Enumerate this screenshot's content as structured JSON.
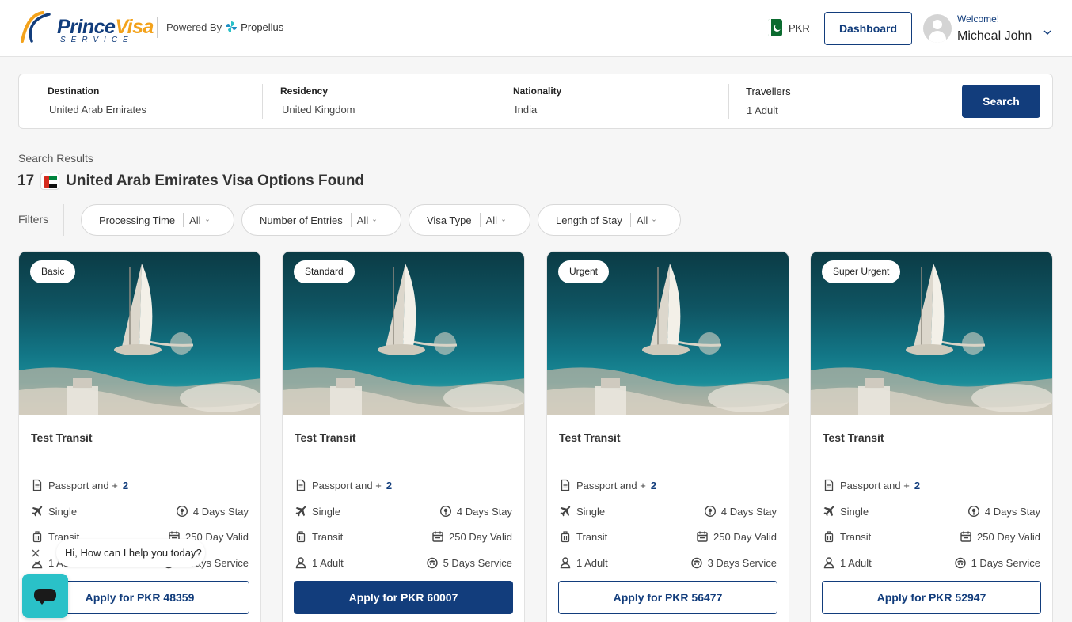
{
  "header": {
    "logo_main": "Prince",
    "logo_accent": "Visa",
    "logo_sub": "SERVICE",
    "powered_by": "Powered By",
    "powered_brand": "Propellus",
    "currency": "PKR",
    "dashboard_label": "Dashboard",
    "welcome": "Welcome!",
    "user_name": "Micheal John"
  },
  "search": {
    "fields": [
      {
        "label": "Destination",
        "value": "United Arab Emirates"
      },
      {
        "label": "Residency",
        "value": "United Kingdom"
      },
      {
        "label": "Nationality",
        "value": "India"
      },
      {
        "label": "Travellers",
        "value": "1 Adult"
      }
    ],
    "button": "Search"
  },
  "results": {
    "label": "Search Results",
    "count": "17",
    "title": "United Arab Emirates Visa Options Found"
  },
  "filters": {
    "label": "Filters",
    "items": [
      {
        "label": "Processing Time",
        "value": "All"
      },
      {
        "label": "Number of Entries",
        "value": "All"
      },
      {
        "label": "Visa Type",
        "value": "All"
      },
      {
        "label": "Length of Stay",
        "value": "All"
      }
    ]
  },
  "cards": [
    {
      "tier": "Basic",
      "title": "Test Transit",
      "docs": "Passport and +",
      "docs_more": "2",
      "entries": "Single",
      "stay": "4 Days Stay",
      "type": "Transit",
      "valid": "250 Day Valid",
      "travellers": "1 Adult",
      "service": "7 Days Service",
      "apply": "Apply for PKR 48359"
    },
    {
      "tier": "Standard",
      "title": "Test Transit",
      "docs": "Passport and +",
      "docs_more": "2",
      "entries": "Single",
      "stay": "4 Days Stay",
      "type": "Transit",
      "valid": "250 Day Valid",
      "travellers": "1 Adult",
      "service": "5 Days Service",
      "apply": "Apply for PKR 60007"
    },
    {
      "tier": "Urgent",
      "title": "Test Transit",
      "docs": "Passport and +",
      "docs_more": "2",
      "entries": "Single",
      "stay": "4 Days Stay",
      "type": "Transit",
      "valid": "250 Day Valid",
      "travellers": "1 Adult",
      "service": "3 Days Service",
      "apply": "Apply for PKR 56477"
    },
    {
      "tier": "Super Urgent",
      "title": "Test Transit",
      "docs": "Passport and +",
      "docs_more": "2",
      "entries": "Single",
      "stay": "4 Days Stay",
      "type": "Transit",
      "valid": "250 Day Valid",
      "travellers": "1 Adult",
      "service": "1 Days Service",
      "apply": "Apply for PKR 52947"
    }
  ],
  "chat": {
    "greeting": "Hi, How can I help you today?"
  },
  "colors": {
    "brand": "#123d7c",
    "accent": "#f3a21b",
    "chat": "#2ac1c8"
  }
}
